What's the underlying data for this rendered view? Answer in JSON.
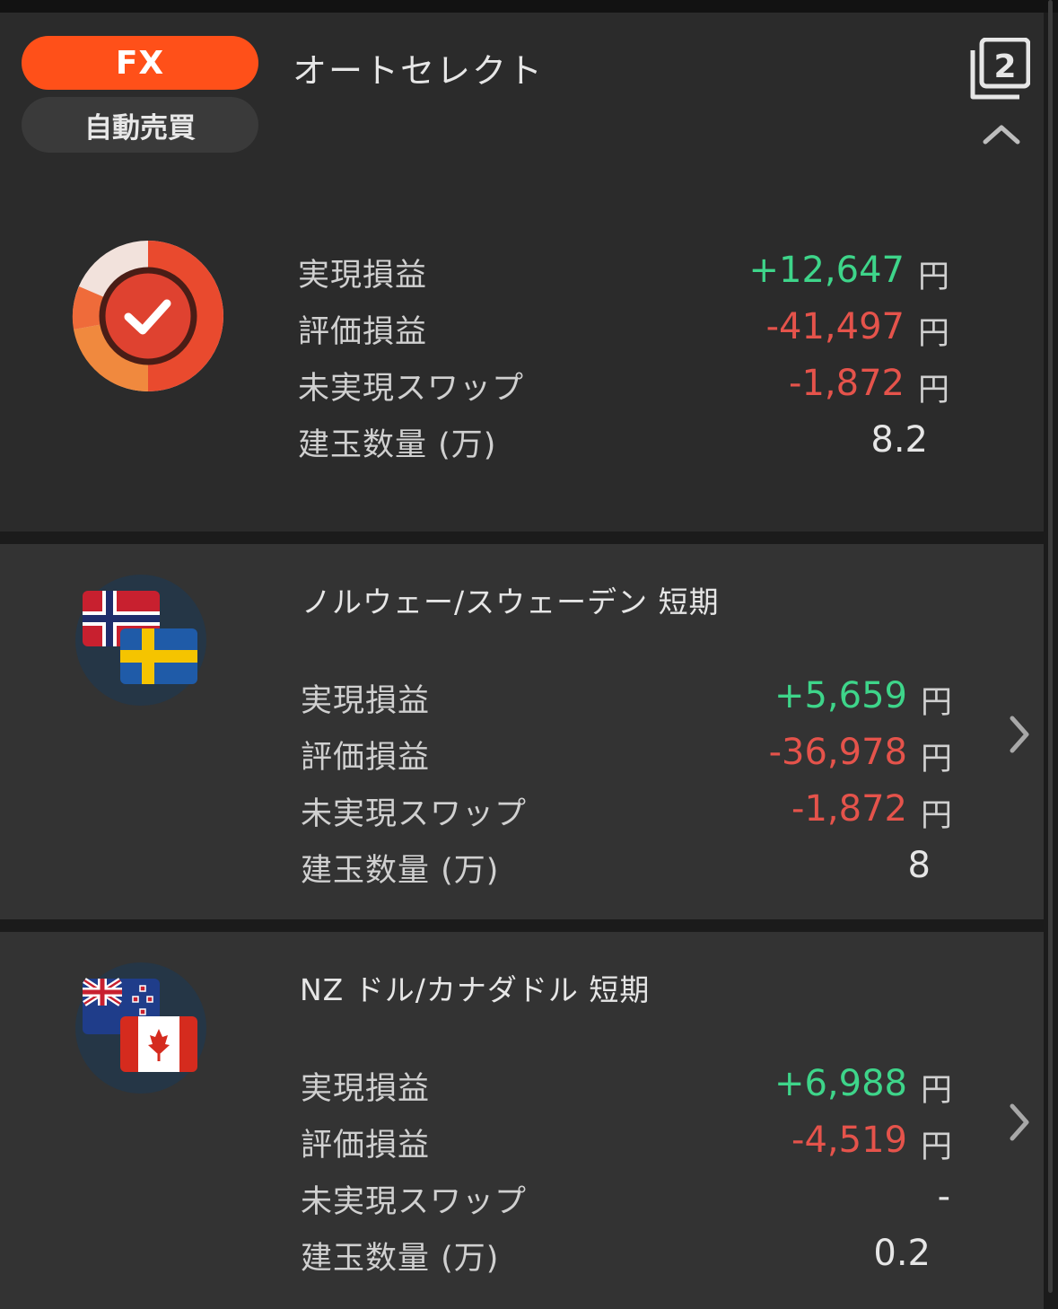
{
  "header": {
    "fx_label": "FX",
    "auto_label": "自動売買",
    "title": "オートセレクト",
    "count": "2",
    "colors": {
      "accent": "#ff5019",
      "positive": "#3ed58a",
      "negative": "#e5534b"
    }
  },
  "summary": {
    "icon": "check-donut-icon",
    "rows": [
      {
        "label": "実現損益",
        "value": "+12,647",
        "unit": "円"
      },
      {
        "label": "評価損益",
        "value": "-41,497",
        "unit": "円"
      },
      {
        "label": "未実現スワップ",
        "value": "-1,872",
        "unit": "円"
      },
      {
        "label": "建玉数量 (万)",
        "value": "8.2",
        "unit": ""
      }
    ]
  },
  "pairs": [
    {
      "title": "ノルウェー/スウェーデン 短期",
      "flags": [
        "norway-flag-icon",
        "sweden-flag-icon"
      ],
      "rows": [
        {
          "label": "実現損益",
          "value": "+5,659",
          "unit": "円"
        },
        {
          "label": "評価損益",
          "value": "-36,978",
          "unit": "円"
        },
        {
          "label": "未実現スワップ",
          "value": "-1,872",
          "unit": "円"
        },
        {
          "label": "建玉数量 (万)",
          "value": "8",
          "unit": ""
        }
      ]
    },
    {
      "title": "NZ ドル/カナダドル 短期",
      "flags": [
        "new-zealand-flag-icon",
        "canada-flag-icon"
      ],
      "rows": [
        {
          "label": "実現損益",
          "value": "+6,988",
          "unit": "円"
        },
        {
          "label": "評価損益",
          "value": "-4,519",
          "unit": "円"
        },
        {
          "label": "未実現スワップ",
          "value": "-",
          "unit": ""
        },
        {
          "label": "建玉数量 (万)",
          "value": "0.2",
          "unit": ""
        }
      ]
    }
  ]
}
